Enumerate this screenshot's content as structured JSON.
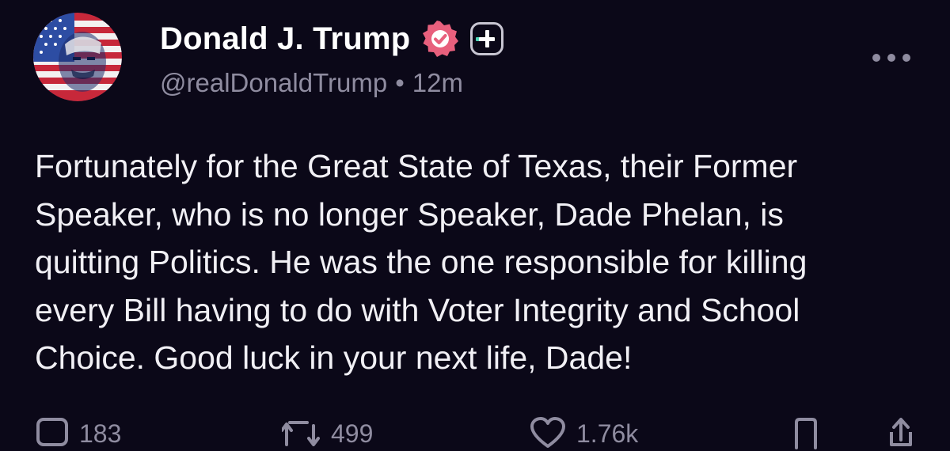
{
  "post": {
    "author": {
      "display_name": "Donald J. Trump",
      "handle": "@realDonaldTrump",
      "separator": "•",
      "time": "12m",
      "verified_color": "#e8607d",
      "avatar_icon": "avatar-flag-portrait-icon"
    },
    "text": "Fortunately for the Great State of Texas, their Former\nSpeaker, who is no longer Speaker, Dade Phelan, is\nquitting Politics. He was the one responsible for killing\nevery Bill having to do with Voter Integrity and School\nChoice. Good luck in your next life, Dade!",
    "actions": {
      "replies": "183",
      "reposts": "499",
      "likes": "1.76k"
    }
  },
  "icons": {
    "more": "more-horizontal-icon",
    "reply": "reply-icon",
    "repost": "repost-icon",
    "like": "heart-icon",
    "bookmark": "bookmark-icon",
    "share": "share-icon"
  },
  "colors": {
    "background": "#0b0818",
    "primary_text": "#f1f0f5",
    "secondary_text": "#8f8ca0",
    "badge_accent": "#4fd6b8"
  }
}
